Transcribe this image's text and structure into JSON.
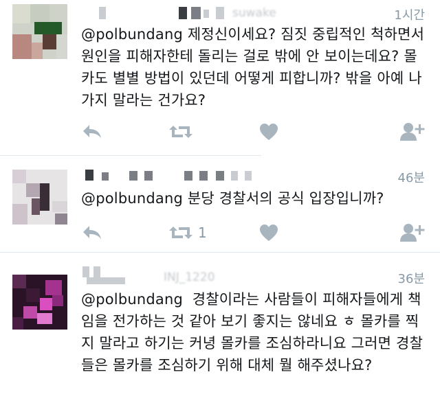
{
  "tweets": [
    {
      "time": "1시간",
      "handle_blur": "suwake",
      "text": "@polbundang 제정신이세요? 짐짓 중립적인 척하면서 원인을 피해자한테 돌리는 걸로 밖에 안 보이는데요? 몰카도 별별 방법이 있던데 어떻게 피합니까? 밖을 아예 나가지 말라는 건가요?",
      "retweet_count": "",
      "icons": [
        "reply-icon",
        "retweet-icon",
        "like-icon",
        "follow-icon"
      ]
    },
    {
      "time": "46분",
      "handle_blur": "",
      "text": "@polbundang 분당 경찰서의 공식 입장입니까?",
      "retweet_count": "1",
      "icons": [
        "reply-icon",
        "retweet-icon",
        "like-icon",
        "follow-icon"
      ]
    },
    {
      "time": "36분",
      "handle_blur": "INJ_1220",
      "text": "@polbundang  경찰이라는 사람들이 피해자들에게 책임을 전가하는 것 같아 보기 좋지는 않네요 ㅎ 몰카를 찍지 말라고 하기는 커녕 몰카를 조심하라니요 그러면 경찰들은 몰카를 조심하기 위해 대체 뭘 해주셨나요?",
      "retweet_count": "",
      "icons": []
    }
  ],
  "colors": {
    "text": "#14171a",
    "muted": "#8899a6",
    "divider": "#e1e8ed"
  }
}
